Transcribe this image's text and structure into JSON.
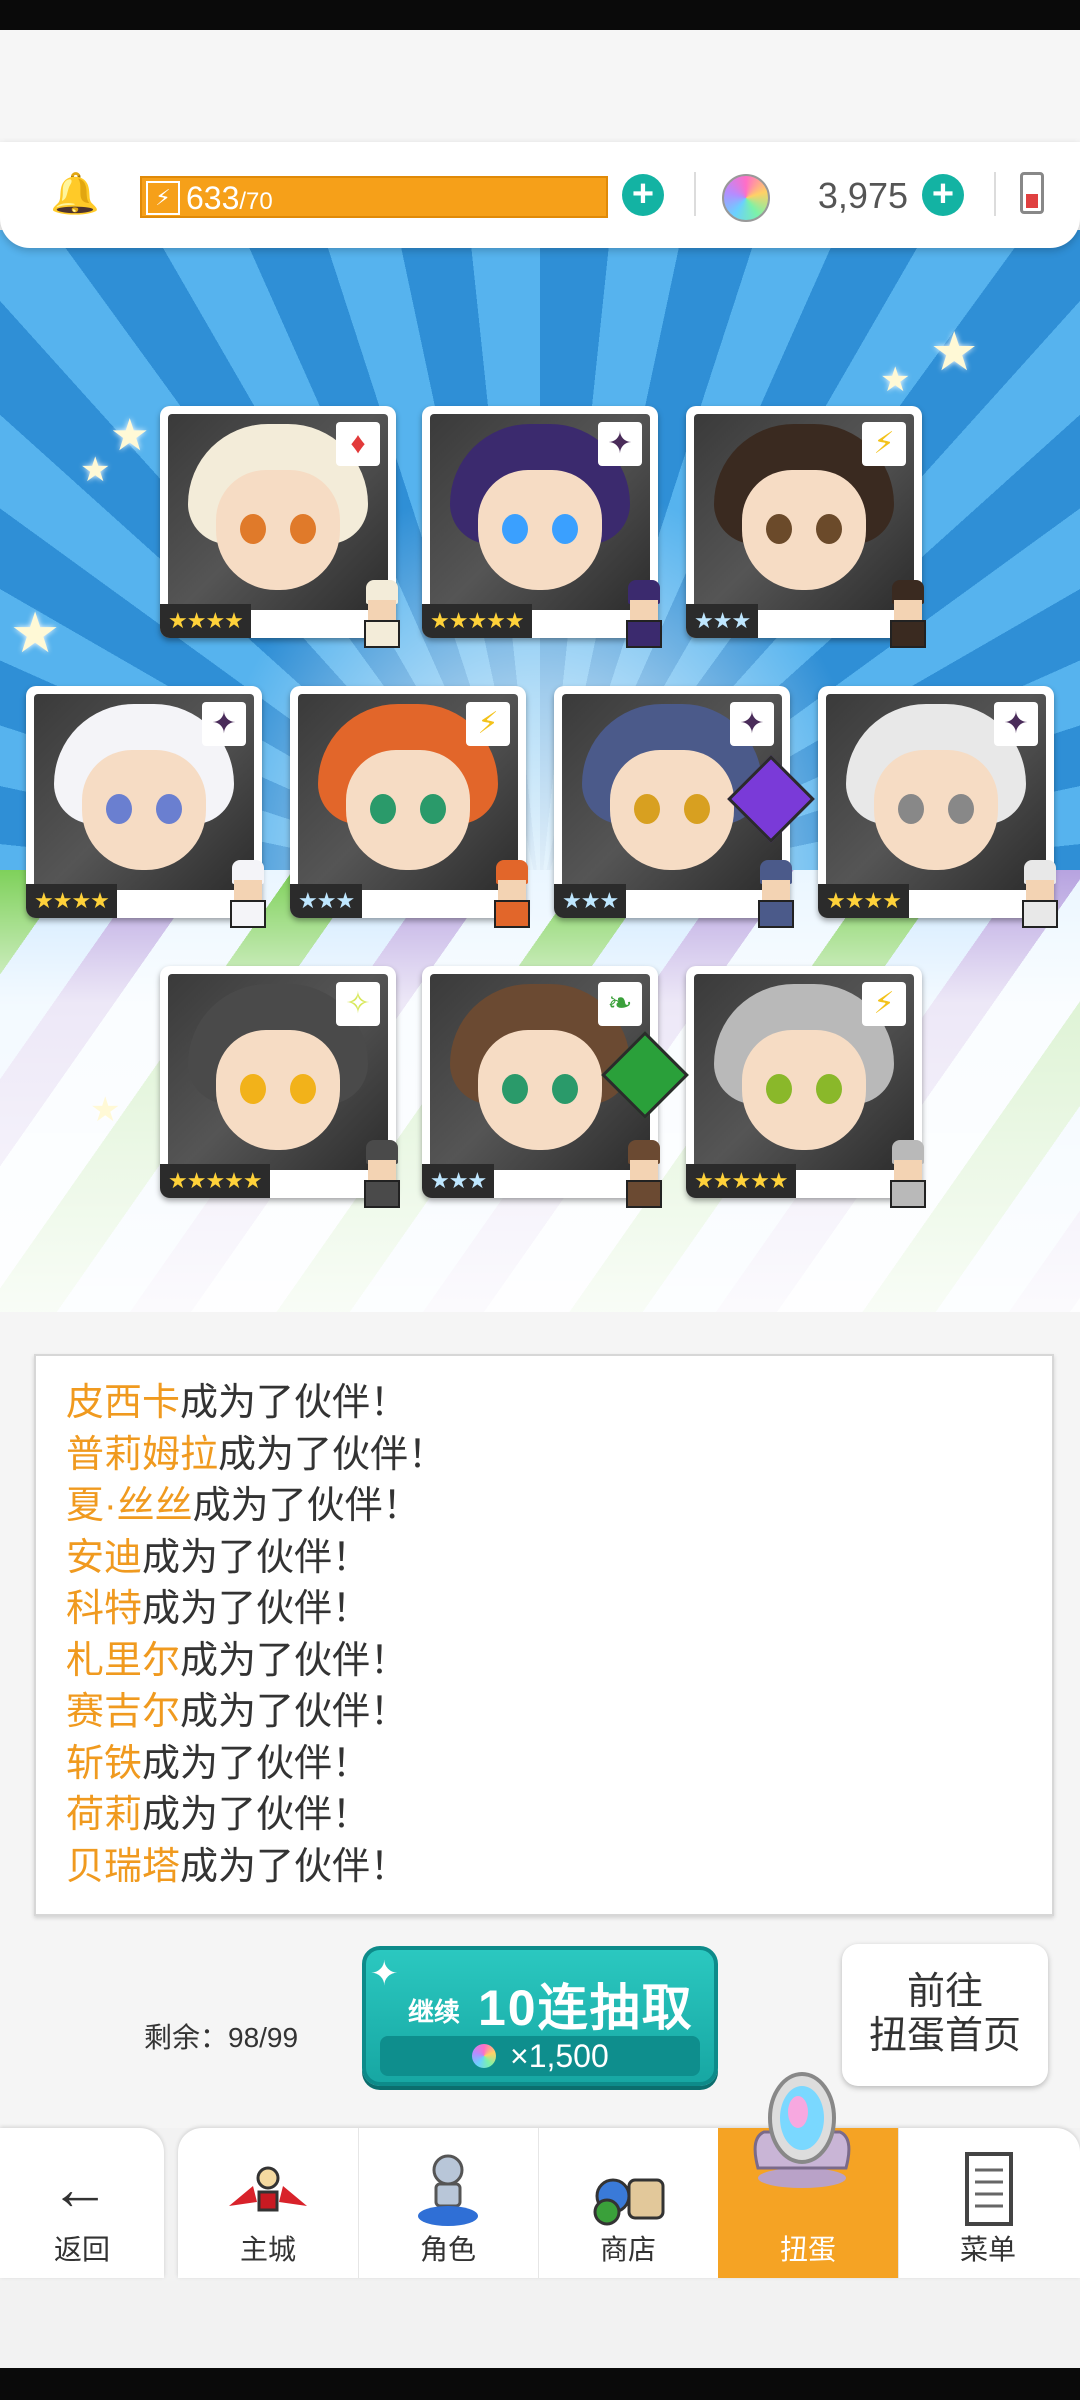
{
  "hud": {
    "energy_current": "633",
    "energy_max": "/70",
    "gem_count": "3,975",
    "bolt_icon": "lightning-icon",
    "bell_icon": "bell-icon"
  },
  "characters": [
    {
      "stars": "★★★★",
      "rarity": "gold",
      "element": "♦",
      "element_icon": "diamond-element-icon",
      "element_color": "#e23a3a",
      "hair": "#f3ecd9",
      "eye": "#e07a2a"
    },
    {
      "stars": "★★★★★",
      "rarity": "gold",
      "element": "✦",
      "element_icon": "dark-element-icon",
      "element_color": "#4a2c5a",
      "hair": "#3b2a6e",
      "eye": "#3aa0ff"
    },
    {
      "stars": "★★★",
      "rarity": "silver",
      "element": "⚡",
      "element_icon": "lightning-element-icon",
      "element_color": "#f3c21a",
      "hair": "#3a2a20",
      "eye": "#6b4a2a"
    },
    {
      "stars": "★★★★",
      "rarity": "gold",
      "element": "✦",
      "element_icon": "dark-element-icon",
      "element_color": "#4a2c5a",
      "hair": "#f4f4f8",
      "eye": "#6a7fd0"
    },
    {
      "stars": "★★★",
      "rarity": "silver",
      "element": "⚡",
      "element_icon": "lightning-element-icon",
      "element_color": "#f3c21a",
      "hair": "#e2662a",
      "eye": "#2a9a6a"
    },
    {
      "stars": "★★★",
      "rarity": "silver",
      "element": "✦",
      "element_icon": "dark-element-icon",
      "element_color": "#4a2c5a",
      "hair": "#4b5a8a",
      "eye": "#d8a020"
    },
    {
      "stars": "★★★★",
      "rarity": "gold",
      "element": "✦",
      "element_icon": "dark-element-icon",
      "element_color": "#4a2c5a",
      "hair": "#e8e8e8",
      "eye": "#888888"
    },
    {
      "stars": "★★★★★",
      "rarity": "gold",
      "element": "✧",
      "element_icon": "light-element-icon",
      "element_color": "#d8e85a",
      "hair": "#4a4a4a",
      "eye": "#f2b21a"
    },
    {
      "stars": "★★★",
      "rarity": "silver",
      "element": "❧",
      "element_icon": "leaf-element-icon",
      "element_color": "#3aa03a",
      "hair": "#6b4a32",
      "eye": "#2a9a6a"
    },
    {
      "stars": "★★★★★",
      "rarity": "gold",
      "element": "⚡",
      "element_icon": "lightning-element-icon",
      "element_color": "#f3c21a",
      "hair": "#b9b9b9",
      "eye": "#8ab82a"
    }
  ],
  "messages": [
    {
      "name": "皮西卡",
      "text": "成为了伙伴！"
    },
    {
      "name": "普莉姆拉",
      "text": "成为了伙伴！"
    },
    {
      "name": "夏·丝丝",
      "text": "成为了伙伴！"
    },
    {
      "name": "安迪",
      "text": "成为了伙伴！"
    },
    {
      "name": "科特",
      "text": "成为了伙伴！"
    },
    {
      "name": "札里尔",
      "text": "成为了伙伴！"
    },
    {
      "name": "赛吉尔",
      "text": "成为了伙伴！"
    },
    {
      "name": "斩铁",
      "text": "成为了伙伴！"
    },
    {
      "name": "荷莉",
      "text": "成为了伙伴！"
    },
    {
      "name": "贝瑞塔",
      "text": "成为了伙伴！"
    }
  ],
  "action": {
    "remaining_label": "剩余：98/99",
    "continue_label": "继续",
    "pull_label": "10连抽取",
    "pull_cost": "×1,500",
    "goto_line1": "前往",
    "goto_line2": "扭蛋首页"
  },
  "nav": {
    "back": "返回",
    "tabs": [
      {
        "label": "主城",
        "icon": "castle-icon"
      },
      {
        "label": "角色",
        "icon": "character-icon"
      },
      {
        "label": "商店",
        "icon": "shop-icon"
      },
      {
        "label": "扭蛋",
        "icon": "gacha-mirror-icon",
        "active": true
      },
      {
        "label": "菜单",
        "icon": "menu-list-icon"
      }
    ]
  },
  "colors": {
    "accent_orange": "#f5a324",
    "teal": "#17a7a3",
    "name_orange": "#f09a1f"
  }
}
